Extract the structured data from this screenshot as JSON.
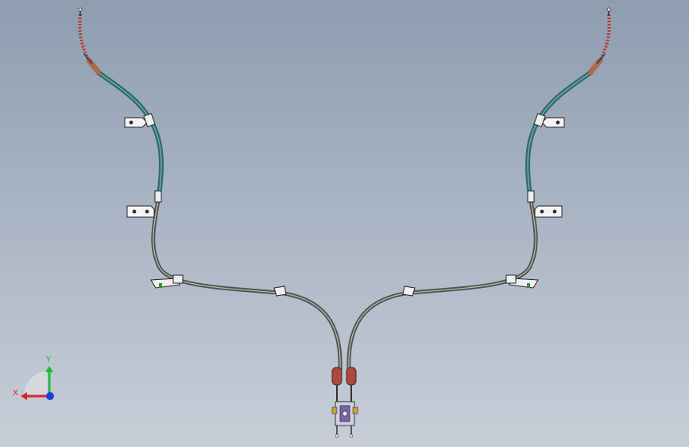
{
  "viewport": {
    "background_top": "#8f9db1",
    "background_bottom": "#c7ced8"
  },
  "triad": {
    "x_label": "X",
    "y_label": "Y",
    "x_color": "#d8262b",
    "y_color": "#27b53a",
    "z_color": "#1f3fd8"
  },
  "model": {
    "name_icon": "brake-cable-assembly",
    "colors": {
      "outer_sheath_green": "#2f6d6b",
      "sheath_grey": "#5a5f58",
      "spring_red": "#b53a2a",
      "clevis_red": "#b0463d",
      "bracket_white": "#f2f2f2",
      "equalizer_purple": "#7b63a8"
    }
  }
}
